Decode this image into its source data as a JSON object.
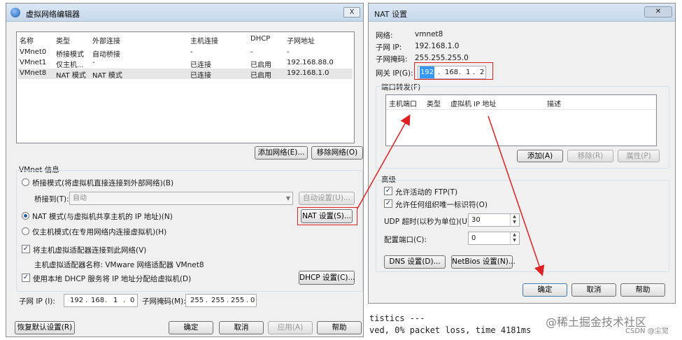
{
  "vne": {
    "title": "虚拟网络编辑器",
    "close_label": "X",
    "table": {
      "headers": [
        "名称",
        "类型",
        "外部连接",
        "主机连接",
        "DHCP",
        "子网地址"
      ],
      "rows": [
        [
          "VMnet0",
          "桥接模式",
          "自动桥接",
          "-",
          "-",
          "-"
        ],
        [
          "VMnet1",
          "仅主机...",
          "-",
          "已连接",
          "已启用",
          "192.168.88.0"
        ],
        [
          "VMnet8",
          "NAT 模式",
          "NAT 模式",
          "已连接",
          "已启用",
          "192.168.1.0"
        ]
      ]
    },
    "add_network": "添加网络(E)...",
    "remove_network": "移除网络(O)",
    "info_title": "VMnet 信息",
    "bridge_mode": "桥接模式(将虚拟机直接连接到外部网络)(B)",
    "bridge_to_label": "桥接到(T):",
    "bridge_to_value": "自动",
    "auto_settings": "自动设置(U)...",
    "nat_mode": "NAT 模式(与虚拟机共享主机的 IP 地址)(N)",
    "nat_settings": "NAT 设置(S)...",
    "host_only_mode": "仅主机模式(在专用网络内连接虚拟机)(H)",
    "connect_adapter": "将主机虚拟适配器连接到此网络(V)",
    "adapter_name": "主机虚拟适配器名称: VMware 网络适配器 VMnet8",
    "use_dhcp": "使用本地 DHCP 服务将 IP 地址分配给虚拟机(D)",
    "dhcp_settings": "DHCP 设置(C)...",
    "subnet_ip_label": "子网 IP (I):",
    "subnet_ip": [
      "192",
      "168",
      "1",
      "0"
    ],
    "subnet_mask_label": "子网掩码(M):",
    "subnet_mask": [
      "255",
      "255",
      "255",
      "0"
    ],
    "restore_defaults": "恢复默认设置(R)",
    "ok": "确定",
    "cancel": "取消",
    "apply": "应用(A)",
    "help": "帮助"
  },
  "nat": {
    "title": "NAT 设置",
    "network_label": "网络:",
    "network_value": "vmnet8",
    "subnet_ip_label": "子网 IP:",
    "subnet_ip_value": "192.168.1.0",
    "subnet_mask_label": "子网掩码:",
    "subnet_mask_value": "255.255.255.0",
    "gateway_label": "网关 IP(G):",
    "gateway": [
      "192",
      "168",
      "1",
      "2"
    ],
    "port_forwarding_title": "端口转发(F)",
    "pf_headers": [
      "主机端口",
      "类型",
      "虚拟机 IP 地址",
      "描述"
    ],
    "pf_add": "添加(A)",
    "pf_remove": "移除(R)",
    "pf_properties": "属性(P)",
    "advanced_title": "高级",
    "allow_ftp": "允许活动的 FTP(T)",
    "allow_any_oui": "允许任何组织唯一标识符(O)",
    "udp_timeout_label": "UDP 超时(以秒为单位)(U):",
    "udp_timeout_value": "30",
    "config_port_label": "配置端口(C):",
    "config_port_value": "0",
    "dns_settings": "DNS 设置(D)...",
    "netbios_settings": "NetBios 设置(N)...",
    "ok": "确定",
    "cancel": "取消",
    "help": "帮助"
  },
  "terminal": {
    "line1": "tistics ---",
    "line2": "ved, 0% packet loss, time 4181ms"
  },
  "watermark": "@稀土掘金技术社区",
  "watermark_small": "CSDN @尘觉",
  "colors": {
    "annotation": "#e02020",
    "selection": "#3399ff"
  }
}
